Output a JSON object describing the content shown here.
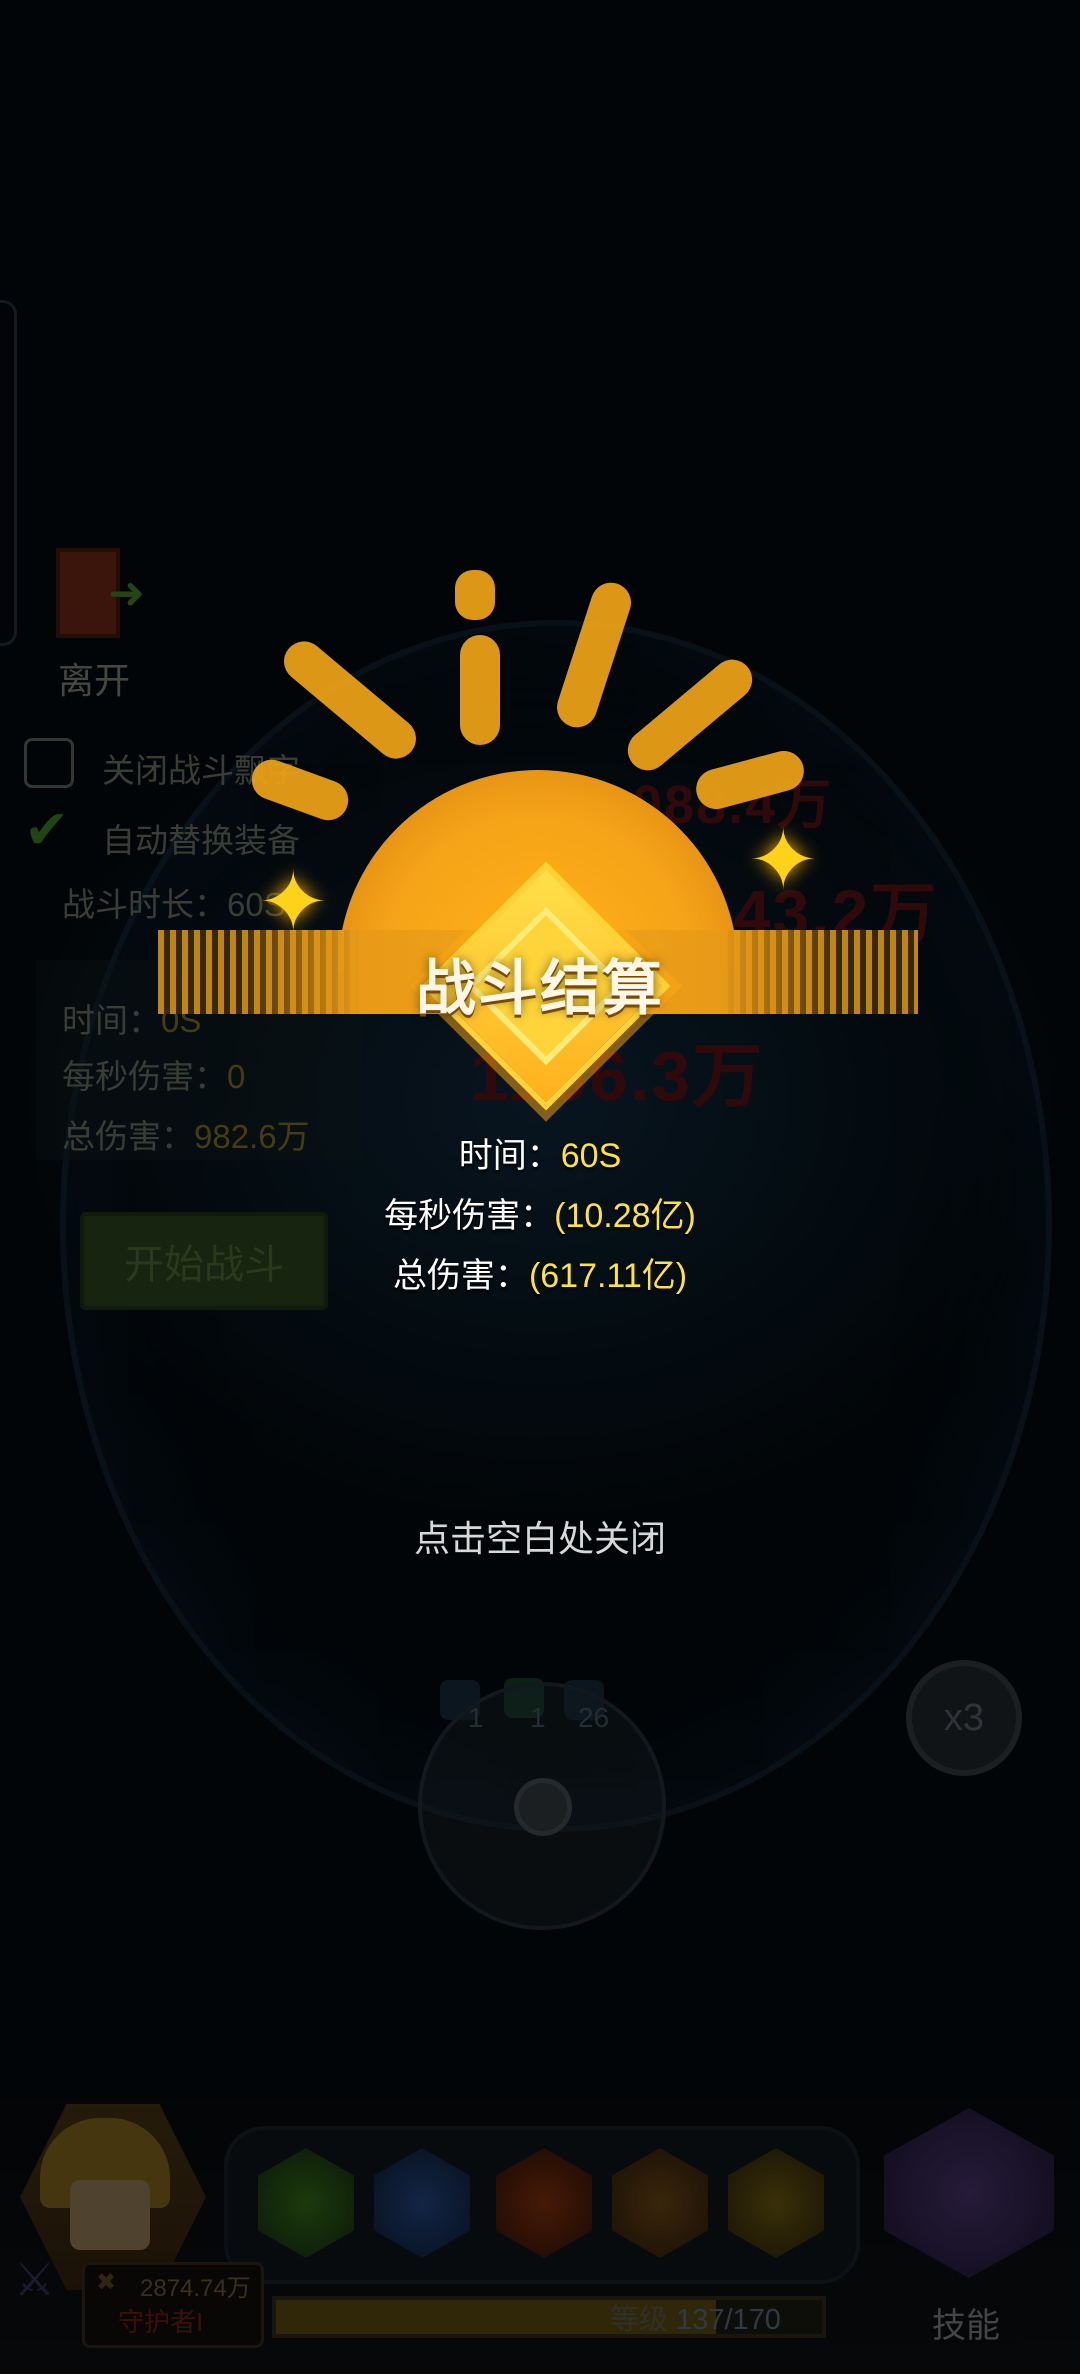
{
  "left_panel": {
    "exit_label": "离开",
    "option1_label": "关闭战斗飘字",
    "option2_label": "自动替换装备",
    "duration_label": "战斗时长：60S",
    "stat_time_label": "时间：",
    "stat_time_value": "0S",
    "stat_dps_label": "每秒伤害：",
    "stat_dps_value": "0",
    "stat_total_label": "总伤害：",
    "stat_total_value": "982.6万",
    "start_button": "开始战斗"
  },
  "background_numbers": {
    "n1": "1088.4万",
    "n2": "1166.3万",
    "n3": "1143.2万"
  },
  "result_popup": {
    "title": "战斗结算",
    "time_label": "时间：",
    "time_value": "60S",
    "dps_label": "每秒伤害：",
    "dps_value": "(10.28亿)",
    "total_label": "总伤害：",
    "total_value": "(617.11亿)",
    "close_hint": "点击空白处关闭"
  },
  "battle_controls": {
    "mini_counts": [
      "1",
      "1",
      "26"
    ],
    "speed_label": "x3"
  },
  "bottom": {
    "power_value": "2874.74万",
    "power_title": "守护者I",
    "level_label": "等级",
    "level_value": "137/170",
    "level_progress": 0.806,
    "skills_label": "技能"
  },
  "icons": {
    "exit": "exit-door-icon",
    "checkmark": "checkmark-icon",
    "sparkle": "sparkle-icon",
    "joystick": "joystick-icon",
    "speed": "speed-icon",
    "hero": "hero-avatar-icon",
    "skills": "skills-book-icon"
  },
  "colors": {
    "accent_gold": "#ffe23a",
    "title_orange": "#f0a418"
  }
}
